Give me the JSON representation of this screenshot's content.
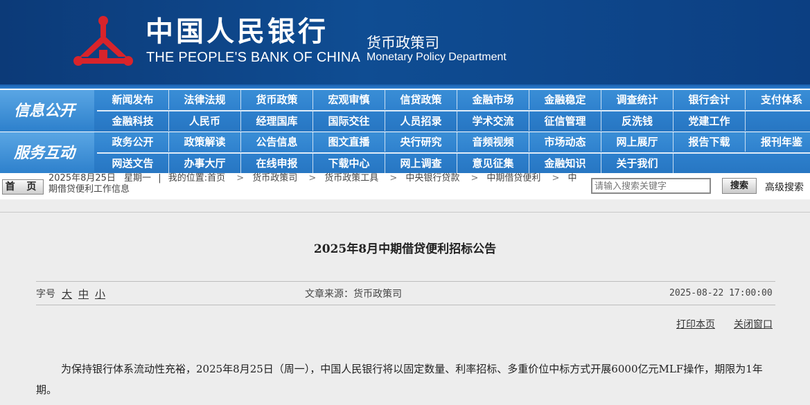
{
  "banner": {
    "bank_name_cn": "中国人民银行",
    "bank_name_en": "THE PEOPLE'S BANK OF CHINA",
    "dept_cn": "货币政策司",
    "dept_en": "Monetary Policy Department",
    "emblem_icon": "pboc-emblem-icon",
    "colors": {
      "banner_blue": "#0f4d93",
      "emblem_red": "#d8242b",
      "nav_blue": "#2d7fcc"
    }
  },
  "nav": {
    "section1_label": "信息公开",
    "section1_row1": [
      "新闻发布",
      "法律法规",
      "货币政策",
      "宏观审慎",
      "信贷政策",
      "金融市场",
      "金融稳定",
      "调查统计",
      "银行会计",
      "支付体系"
    ],
    "section1_row2": [
      "金融科技",
      "人民币",
      "经理国库",
      "国际交往",
      "人员招录",
      "学术交流",
      "征信管理",
      "反洗钱",
      "党建工作"
    ],
    "section2_label": "服务互动",
    "section2_row1": [
      "政务公开",
      "政策解读",
      "公告信息",
      "图文直播",
      "央行研究",
      "音频视频",
      "市场动态",
      "网上展厅",
      "报告下载",
      "报刊年鉴"
    ],
    "section2_row2": [
      "网送文告",
      "办事大厅",
      "在线申报",
      "下载中心",
      "网上调查",
      "意见征集",
      "金融知识",
      "关于我们"
    ]
  },
  "crumbbar": {
    "home_label": "首 页",
    "date": "2025年8月25日",
    "weekday": "星期一",
    "location_prefix": "我的位置:",
    "crumbs": [
      "首页",
      "货币政策司",
      "货币政策工具",
      "中央银行贷款",
      "中期借贷便利",
      "中期借贷便利工作信息"
    ],
    "search_placeholder": "请输入搜索关键字",
    "search_button": "搜索",
    "advanced_search": "高级搜索"
  },
  "article": {
    "title": "2025年8月中期借贷便利招标公告",
    "font_size_label": "字号",
    "font_sizes": [
      "大",
      "中",
      "小"
    ],
    "source": "文章来源：货币政策司",
    "datetime": "2025-08-22 17:00:00",
    "print_link": "打印本页",
    "close_link": "关闭窗口",
    "body": "为保持银行体系流动性充裕，2025年8月25日（周一），中国人民银行将以固定数量、利率招标、多重价位中标方式开展6000亿元MLF操作，期限为1年期。"
  }
}
